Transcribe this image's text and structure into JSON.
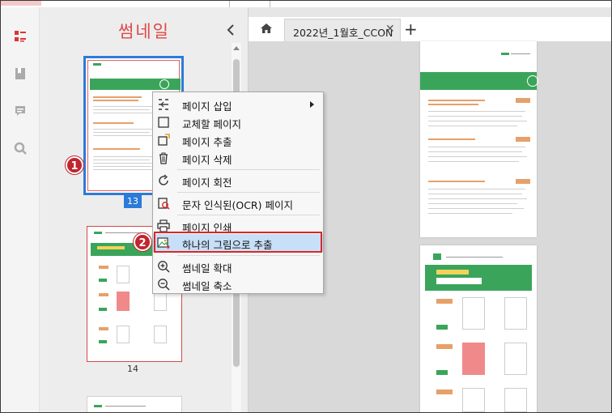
{
  "panel": {
    "title": "썸네일",
    "collapse_glyph": "<",
    "thumbnails": [
      {
        "page": "13",
        "selected": true
      },
      {
        "page": "14",
        "selected": false
      }
    ]
  },
  "iconbar": {
    "items": [
      "thumbnail-list-icon",
      "bookmark-icon",
      "comment-icon",
      "search-icon"
    ]
  },
  "tabs": {
    "active_title": "2022년_1월호_CCON",
    "close_glyph": "✕",
    "add_glyph": "+"
  },
  "context_menu": {
    "items": [
      {
        "label": "페이지 삽입",
        "icon": "insert-page-icon",
        "submenu": true
      },
      {
        "label": "교체할 페이지",
        "icon": "replace-page-icon"
      },
      {
        "label": "페이지 추출",
        "icon": "extract-page-icon"
      },
      {
        "label": "페이지 삭제",
        "icon": "delete-page-icon"
      },
      {
        "label": "페이지 회전",
        "icon": "rotate-page-icon"
      },
      {
        "label": "문자 인식된(OCR) 페이지",
        "icon": "ocr-page-icon"
      },
      {
        "label": "페이지 인쇄",
        "icon": "print-page-icon"
      },
      {
        "label": "하나의 그림으로 추출",
        "icon": "extract-image-icon",
        "highlighted": true
      },
      {
        "label": "썸네일 확대",
        "icon": "zoom-in-icon"
      },
      {
        "label": "썸네일 축소",
        "icon": "zoom-out-icon"
      }
    ]
  },
  "badges": {
    "step1": "1",
    "step2": "2"
  },
  "colors": {
    "accent_blue": "#2c7bd8",
    "title_red": "#e04848",
    "badge_red": "#c0262d",
    "highlight": "#c7e0f7",
    "doc_green": "#3aa55a"
  }
}
